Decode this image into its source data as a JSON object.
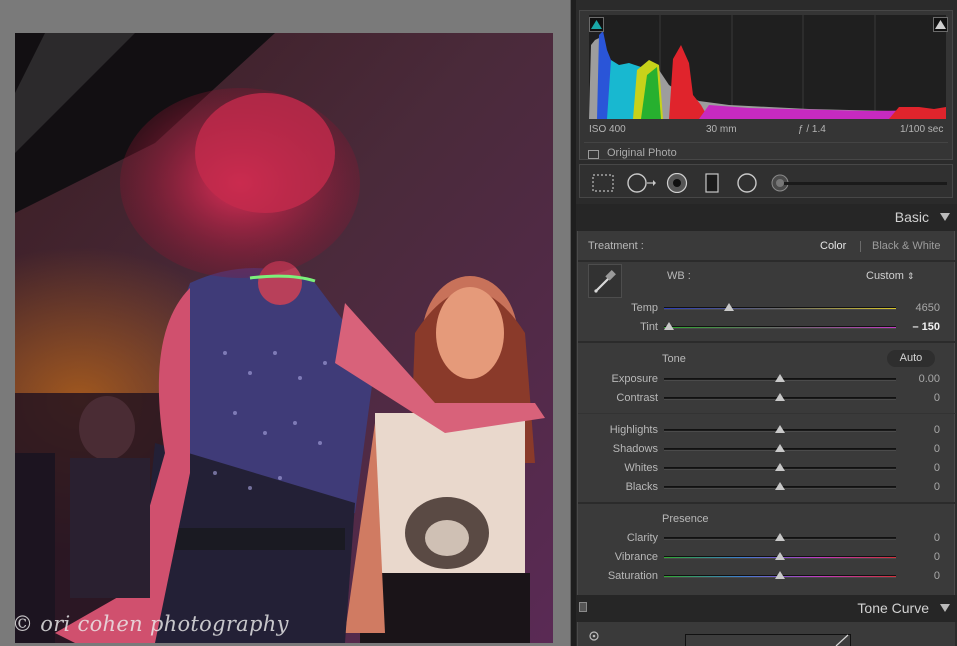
{
  "canvas": {
    "watermark": "© ori cohen photography"
  },
  "histogram": {
    "iso": "ISO 400",
    "focal_length": "30 mm",
    "aperture": "ƒ / 1.4",
    "shutter": "1/100 sec",
    "original_photo_label": "Original Photo",
    "shadow_clip_color": "#1aa6a6",
    "highlight_clip_color": "#cfcfcf"
  },
  "tools": {
    "icons": [
      "crop-overlay-icon",
      "spot-removal-icon",
      "red-eye-icon",
      "graduated-filter-icon",
      "radial-filter-icon",
      "adjustment-brush-icon"
    ]
  },
  "basic": {
    "title": "Basic",
    "treatment_label": "Treatment :",
    "treatment_color": "Color",
    "treatment_bw": "Black & White",
    "wb_label": "WB :",
    "wb_value": "Custom",
    "wb_arrows": "⇕",
    "temp_label": "Temp",
    "temp_value": "4650",
    "temp_pos": 0.28,
    "tint_label": "Tint",
    "tint_value": "– 150",
    "tint_pos": 0.02,
    "tone_label": "Tone",
    "auto_label": "Auto",
    "sliders_tone": [
      {
        "label": "Exposure",
        "value": "0.00",
        "pos": 0.5
      },
      {
        "label": "Contrast",
        "value": "0",
        "pos": 0.5
      }
    ],
    "sliders_tone2": [
      {
        "label": "Highlights",
        "value": "0",
        "pos": 0.5
      },
      {
        "label": "Shadows",
        "value": "0",
        "pos": 0.5
      },
      {
        "label": "Whites",
        "value": "0",
        "pos": 0.5
      },
      {
        "label": "Blacks",
        "value": "0",
        "pos": 0.5
      }
    ],
    "presence_label": "Presence",
    "sliders_presence": [
      {
        "label": "Clarity",
        "value": "0",
        "pos": 0.5
      },
      {
        "label": "Vibrance",
        "value": "0",
        "pos": 0.5
      },
      {
        "label": "Saturation",
        "value": "0",
        "pos": 0.5
      }
    ]
  },
  "tone_curve": {
    "title": "Tone Curve"
  }
}
